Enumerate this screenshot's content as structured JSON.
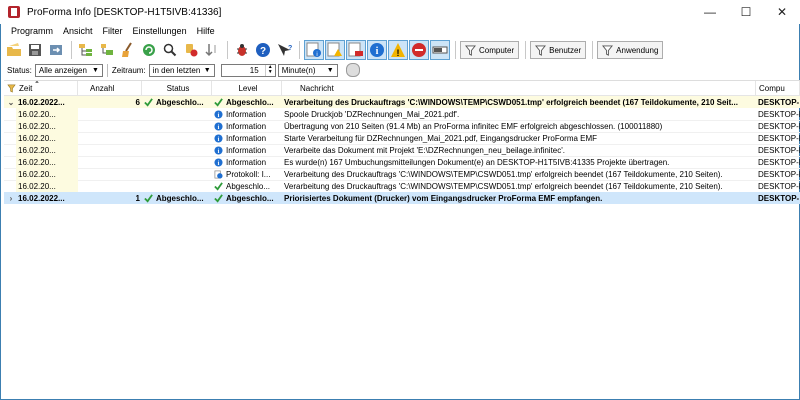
{
  "window": {
    "title": "ProForma Info [DESKTOP-H1T5IVB:41336]",
    "minimize": "—",
    "maximize": "☐",
    "close": "✕"
  },
  "menu": [
    "Programm",
    "Ansicht",
    "Filter",
    "Einstellungen",
    "Hilfe"
  ],
  "toolbar": {
    "computer_label": "Computer",
    "benutzer_label": "Benutzer",
    "anwendung_label": "Anwendung"
  },
  "filter": {
    "status_label": "Status:",
    "status_value": "Alle anzeigen",
    "zeitraum_label": "Zeitraum:",
    "zeitraum_value": "in den letzten",
    "amount": "15",
    "unit_value": "Minute(n)"
  },
  "columns": {
    "time": "Zeit",
    "count": "Anzahl",
    "status": "Status",
    "level": "Level",
    "message": "Nachricht",
    "computer": "Compu"
  },
  "rows": [
    {
      "kind": "group",
      "expander": "⌄",
      "time": "16.02.2022...",
      "count": "6",
      "status": "Abgeschlo...",
      "level": "Abgeschlo...",
      "level_icon": "check",
      "message": "Verarbeitung des Druckauftrags 'C:\\WINDOWS\\TEMP\\CSWD051.tmp' erfolgreich beendet (167 Teildokumente, 210 Seit...",
      "computer": "DESKTOP-"
    },
    {
      "kind": "child",
      "time": "16.02.20...",
      "level": "Information",
      "level_icon": "info",
      "message": "Spoole Druckjob 'DZRechnungen_Mai_2021.pdf'.",
      "computer": "DESKTOP-H"
    },
    {
      "kind": "child",
      "time": "16.02.20...",
      "level": "Information",
      "level_icon": "info",
      "message": "Übertragung von 210 Seiten (91.4 Mb) an ProForma infinitec EMF erfolgreich abgeschlossen. (100011880)",
      "computer": "DESKTOP-H"
    },
    {
      "kind": "child",
      "time": "16.02.20...",
      "level": "Information",
      "level_icon": "info",
      "message": "Starte Verarbeitung für DZRechnungen_Mai_2021.pdf, Eingangsdrucker ProForma EMF",
      "computer": "DESKTOP-H"
    },
    {
      "kind": "child",
      "time": "16.02.20...",
      "level": "Information",
      "level_icon": "info",
      "message": "Verarbeite das Dokument mit Projekt 'E:\\DZRechnungen_neu_beilage.infinitec'.",
      "computer": "DESKTOP-H"
    },
    {
      "kind": "child",
      "time": "16.02.20...",
      "level": "Information",
      "level_icon": "info",
      "message": "Es wurde(n) 167 Umbuchungsmitteilungen Dokument(e) an DESKTOP-H1T5IVB:41335 Projekte übertragen.",
      "computer": "DESKTOP-H"
    },
    {
      "kind": "child",
      "time": "16.02.20...",
      "level": "Protokoll: I...",
      "level_icon": "protocol",
      "message": "Verarbeitung des Druckauftrags 'C:\\WINDOWS\\TEMP\\CSWD051.tmp' erfolgreich beendet (167 Teildokumente, 210 Seiten).",
      "computer": "DESKTOP-H"
    },
    {
      "kind": "child",
      "time": "16.02.20...",
      "level": "Abgeschlo...",
      "level_icon": "check",
      "message": "Verarbeitung des Druckauftrags 'C:\\WINDOWS\\TEMP\\CSWD051.tmp' erfolgreich beendet (167 Teildokumente, 210 Seiten).",
      "computer": "DESKTOP-H"
    },
    {
      "kind": "selected",
      "expander": "›",
      "time": "16.02.2022...",
      "count": "1",
      "status": "Abgeschlo...",
      "level": "Abgeschlo...",
      "level_icon": "check",
      "message": "Priorisiertes Dokument (Drucker) vom Eingangsdrucker ProForma EMF empfangen.",
      "computer": "DESKTOP-"
    }
  ]
}
